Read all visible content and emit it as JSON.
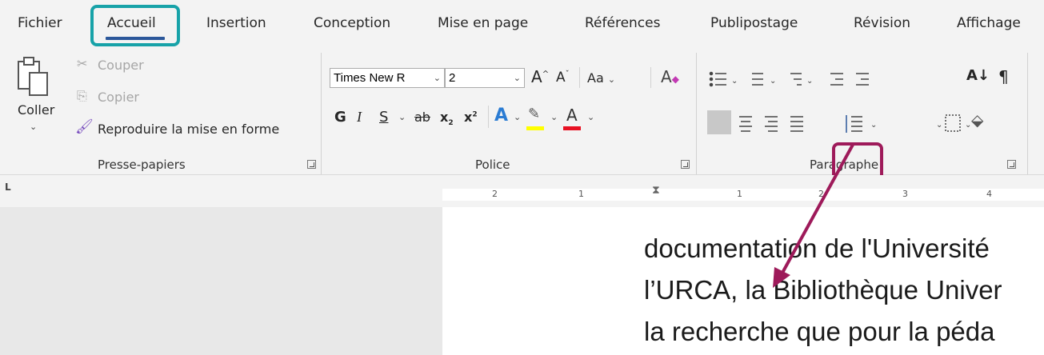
{
  "tabs": [
    {
      "label": "Fichier"
    },
    {
      "label": "Accueil",
      "active": true
    },
    {
      "label": "Insertion"
    },
    {
      "label": "Conception"
    },
    {
      "label": "Mise en page"
    },
    {
      "label": "Références"
    },
    {
      "label": "Publipostage"
    },
    {
      "label": "Révision"
    },
    {
      "label": "Affichage"
    }
  ],
  "clipboard": {
    "paste_label": "Coller",
    "cut_label": "Couper",
    "copy_label": "Copier",
    "format_painter_label": "Reproduire la mise en forme",
    "group_label": "Presse-papiers"
  },
  "font": {
    "font_name": "Times New R",
    "font_size": "2",
    "group_label": "Police",
    "bold": "G",
    "italic": "I",
    "underline": "S",
    "change_case": "Aa",
    "grow": "A",
    "shrink": "A",
    "text_effects": "A",
    "font_color": "A",
    "highlight_color": "#ffff00",
    "font_color_value": "#e81123"
  },
  "paragraph": {
    "group_label": "Paragraphe",
    "sort": "A↓",
    "pilcrow": "¶"
  },
  "colors": {
    "active_tab_underline": "#2b579a",
    "tab_highlight": "#17a2a8",
    "callout": "#9e1a5a"
  },
  "ruler": {
    "tab_selector": "L",
    "ticks": [
      "2",
      "1",
      "1",
      "2",
      "3",
      "4"
    ]
  },
  "document": {
    "lines": [
      "documentation de l'Université",
      "l’URCA, la Bibliothèque Univer",
      "la recherche que pour la péda"
    ]
  }
}
